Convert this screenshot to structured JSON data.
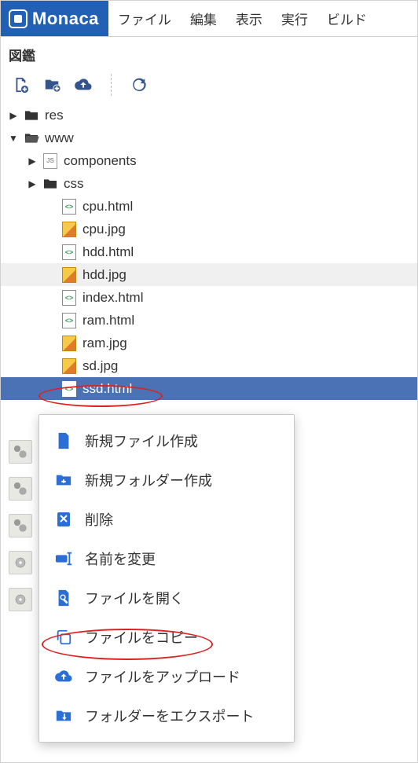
{
  "brand": {
    "name": "Monaca"
  },
  "menu": {
    "file": "ファイル",
    "edit": "編集",
    "view": "表示",
    "run": "実行",
    "build": "ビルド"
  },
  "project": {
    "title": "図鑑"
  },
  "toolbar": {
    "new_file": "new-file",
    "new_folder": "new-folder",
    "upload": "upload",
    "refresh": "refresh"
  },
  "tree": {
    "res": {
      "name": "res",
      "type": "folder",
      "expanded": false,
      "depth": 0
    },
    "www": {
      "name": "www",
      "type": "folder",
      "expanded": true,
      "depth": 0
    },
    "components": {
      "name": "components",
      "type": "folder-js",
      "expanded": false,
      "depth": 1
    },
    "css": {
      "name": "css",
      "type": "folder",
      "expanded": false,
      "depth": 1
    },
    "cpu_html": {
      "name": "cpu.html",
      "type": "code",
      "depth": 2
    },
    "cpu_jpg": {
      "name": "cpu.jpg",
      "type": "img",
      "depth": 2
    },
    "hdd_html": {
      "name": "hdd.html",
      "type": "code",
      "depth": 2
    },
    "hdd_jpg": {
      "name": "hdd.jpg",
      "type": "img",
      "depth": 2,
      "hovered": true
    },
    "index_html": {
      "name": "index.html",
      "type": "code",
      "depth": 2
    },
    "ram_html": {
      "name": "ram.html",
      "type": "code",
      "depth": 2
    },
    "ram_jpg": {
      "name": "ram.jpg",
      "type": "img",
      "depth": 2
    },
    "sd_jpg": {
      "name": "sd.jpg",
      "type": "img",
      "depth": 2
    },
    "ssd_html": {
      "name": "ssd.html",
      "type": "code",
      "depth": 2,
      "selected": true
    }
  },
  "context_menu": {
    "new_file": "新規ファイル作成",
    "new_folder": "新規フォルダー作成",
    "delete": "削除",
    "rename": "名前を変更",
    "open": "ファイルを開く",
    "copy": "ファイルをコピー",
    "upload": "ファイルをアップロード",
    "export": "フォルダーをエクスポート"
  },
  "colors": {
    "accent": "#2160b5",
    "selection": "#4a72b5",
    "annotation": "#d22"
  }
}
